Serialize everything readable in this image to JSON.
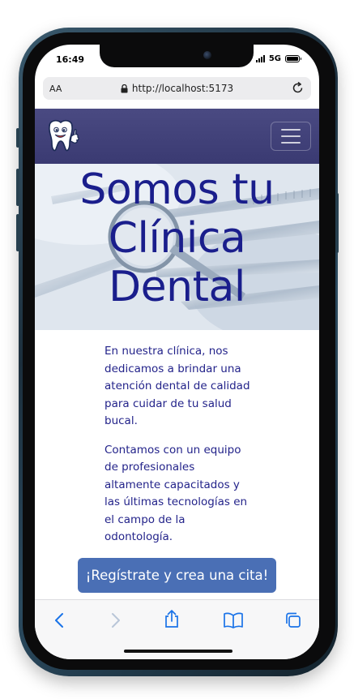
{
  "status_bar": {
    "time": "16:49",
    "network": "5G",
    "battery_level": 1.0,
    "icons": [
      "signal-icon",
      "battery-icon"
    ]
  },
  "browser": {
    "text_size_button": "AA",
    "url": "http://localhost:5173",
    "icons": [
      "lock-icon",
      "reload-icon"
    ]
  },
  "site_nav": {
    "icons": [
      "tooth-logo-icon",
      "hamburger-menu-icon"
    ],
    "colors": {
      "nav_background": "#44447b"
    }
  },
  "hero": {
    "title_lines": [
      "Somos tu",
      "Clínica",
      "Dental"
    ],
    "colors": {
      "title": "#1a1e8c"
    }
  },
  "content": {
    "paragraphs": [
      "En nuestra clínica, nos dedicamos a brindar una atención dental de calidad para cuidar de tu salud bucal.",
      "Contamos con un equipo de profesionales altamente capacitados y las últimas tecnologías en el campo de la odontología."
    ],
    "colors": {
      "text": "#23238a"
    }
  },
  "cta": {
    "label": "¡Regístrate y crea una cita!",
    "colors": {
      "background": "#4a6fb5",
      "text": "#ffffff"
    }
  },
  "toolbar": {
    "icons": [
      "back-icon",
      "forward-icon",
      "share-icon",
      "bookmarks-icon",
      "tabs-icon"
    ],
    "colors": {
      "active": "#1a73e8",
      "disabled": "#b9c6d8"
    }
  }
}
